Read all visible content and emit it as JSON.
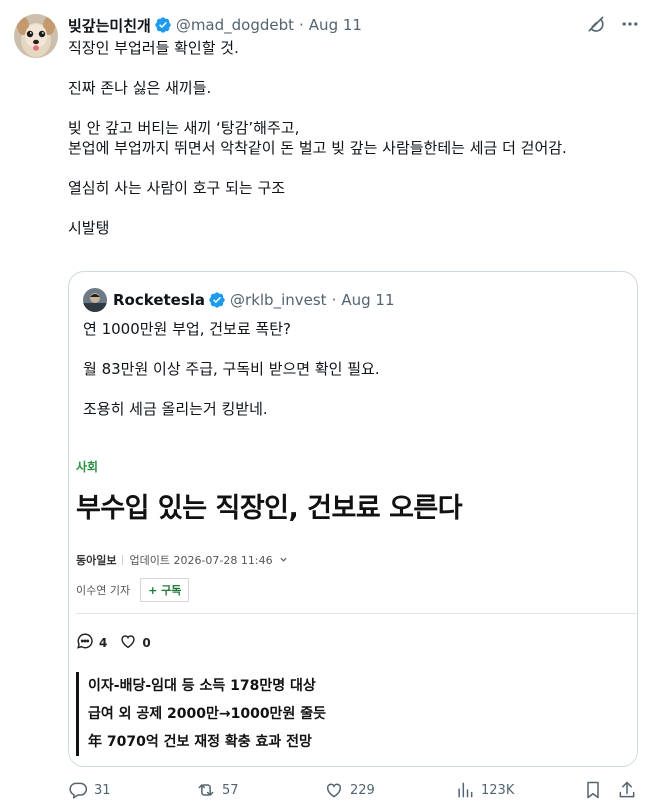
{
  "tweet": {
    "display_name": "빚갚는미친개",
    "handle": "@mad_dogdebt",
    "date": "Aug 11",
    "body_lines": [
      "직장인 부업러들 확인할 것.",
      "",
      "진짜 존나 싫은 새끼들.",
      "",
      "빚 안 갚고 버티는 새끼 ‘탕감’해주고,",
      "본업에 부업까지 뛰면서 악착같이 돈 벌고 빚 갚는 사람들한테는 세금 더 걷어감.",
      "",
      "열심히 사는 사람이 호구 되는 구조",
      "",
      "시발탱"
    ]
  },
  "quoted": {
    "display_name": "Rocketesla",
    "handle": "@rklb_invest",
    "date": "Aug 11",
    "body_lines": [
      "연 1000만원 부업, 건보료 폭탄?",
      "",
      "월 83만원 이상 주급, 구독비 받으면 확인 필요.",
      "",
      "조용히 세금 올리는거 킹받네."
    ],
    "article": {
      "section": "사회",
      "headline": "부수입 있는 직장인, 건보료 오른다",
      "publisher": "동아일보",
      "updated": "업데이트 2026-07-28 11:46",
      "reporter": "이수연 기자",
      "subscribe": "+ 구독",
      "comments": "4",
      "likes": "0",
      "summary": [
        "이자-배당-임대 등 소득 178만명 대상",
        "급여 외 공제 2000만→1000만원 줄듯",
        "年 7070억 건보 재정 확충 효과 전망"
      ]
    }
  },
  "actions": {
    "replies": "31",
    "reposts": "57",
    "likes": "229",
    "views": "123K"
  },
  "colors": {
    "verified": "#1d9bf0",
    "muted": "#536471",
    "border": "#cfd9de",
    "section_green": "#2a8f45"
  }
}
